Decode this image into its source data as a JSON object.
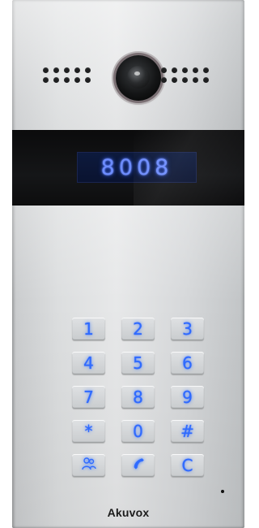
{
  "display": {
    "text": "8008"
  },
  "keypad": {
    "keys": [
      {
        "label": "1",
        "name": "key-1"
      },
      {
        "label": "2",
        "name": "key-2"
      },
      {
        "label": "3",
        "name": "key-3"
      },
      {
        "label": "4",
        "name": "key-4"
      },
      {
        "label": "5",
        "name": "key-5"
      },
      {
        "label": "6",
        "name": "key-6"
      },
      {
        "label": "7",
        "name": "key-7"
      },
      {
        "label": "8",
        "name": "key-8"
      },
      {
        "label": "9",
        "name": "key-9"
      },
      {
        "label": "*",
        "name": "key-star"
      },
      {
        "label": "0",
        "name": "key-0"
      },
      {
        "label": "#",
        "name": "key-hash"
      },
      {
        "icon": "contacts-icon",
        "name": "key-contacts"
      },
      {
        "icon": "call-icon",
        "name": "key-call"
      },
      {
        "label": "C",
        "name": "key-clear"
      }
    ]
  },
  "brand": {
    "name": "Akuvox"
  },
  "colors": {
    "key_glow": "#2f6bff",
    "display_text": "#6d8cff",
    "display_bg": "#0d1a3d",
    "band": "#0b0b0c"
  }
}
